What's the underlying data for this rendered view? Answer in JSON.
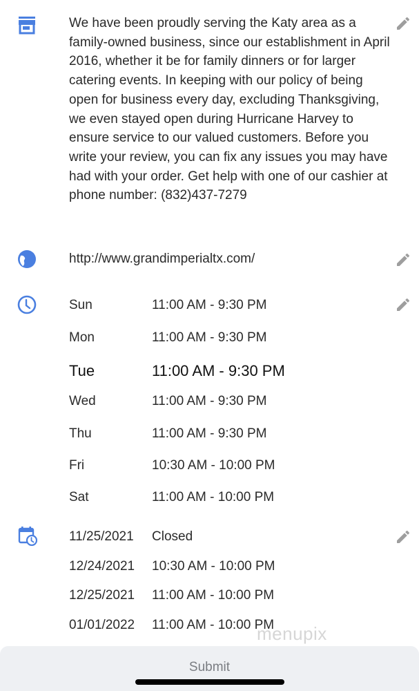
{
  "colors": {
    "accent": "#4a7fe0",
    "edit_icon": "#9e9e9e",
    "text": "#2a2a2a",
    "submit_bar": "#eef0f3"
  },
  "description": {
    "icon": "store-icon",
    "text": "We have been proudly serving the Katy area as a family-owned business, since our establishment in April 2016, whether it be for family dinners or for larger catering events. In keeping with our policy of being open for business every day, excluding Thanksgiving, we even stayed open during Hurricane Harvey to ensure service to our valued customers. Before you write your review, you can fix any issues you may have had with your order. Get help with one of our cashier at phone number: (832)437-7279"
  },
  "website": {
    "icon": "globe-icon",
    "url": "http://www.grandimperialtx.com/"
  },
  "hours": {
    "icon": "clock-icon",
    "days": [
      {
        "day": "Sun",
        "time": "11:00 AM - 9:30 PM"
      },
      {
        "day": "Mon",
        "time": "11:00 AM - 9:30 PM"
      },
      {
        "day": "Tue",
        "time": "11:00 AM - 9:30 PM",
        "today": true
      },
      {
        "day": "Wed",
        "time": "11:00 AM - 9:30 PM"
      },
      {
        "day": "Thu",
        "time": "11:00 AM - 9:30 PM"
      },
      {
        "day": "Fri",
        "time": "10:30 AM - 10:00 PM"
      },
      {
        "day": "Sat",
        "time": "11:00 AM - 10:00 PM"
      }
    ]
  },
  "special_hours": {
    "icon": "calendar-clock-icon",
    "entries": [
      {
        "date": "11/25/2021",
        "time": "Closed"
      },
      {
        "date": "12/24/2021",
        "time": "10:30 AM - 10:00 PM"
      },
      {
        "date": "12/25/2021",
        "time": "11:00 AM - 10:00 PM"
      },
      {
        "date": "01/01/2022",
        "time": "11:00 AM - 10:00 PM"
      }
    ]
  },
  "watermark": "menupix",
  "footer": {
    "submit_label": "Submit"
  }
}
